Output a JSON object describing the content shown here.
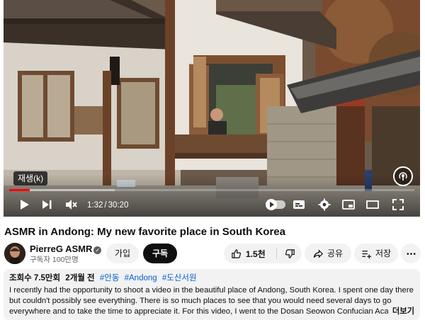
{
  "player": {
    "tooltip": "재생(k)",
    "current_time": "1:32",
    "time_separator": "/",
    "duration": "30:20",
    "progress_played": 0.0505,
    "progress_loaded": 0.26,
    "icons": [
      "play-icon",
      "next-icon",
      "mute-icon",
      "autoplay-toggle",
      "subtitles-icon",
      "settings-icon",
      "miniplayer-icon",
      "theater-icon",
      "fullscreen-icon",
      "podcast-icon"
    ]
  },
  "video": {
    "title": "ASMR in Andong: My new favorite place in South Korea"
  },
  "channel": {
    "name": "PierreG ASMR",
    "subscribers": "구독자 100만명",
    "join_label": "가입",
    "subscribe_label": "구독"
  },
  "actions": {
    "like_count": "1.5천",
    "share_label": "공유",
    "save_label": "저장"
  },
  "description": {
    "views": "조회수 7.5만회",
    "date": "2개월 전",
    "tags": [
      "#안동",
      "#Andong",
      "#도산서원"
    ],
    "text": "I recently had the opportunity to shoot a video in the beautiful place of Andong, South Korea. I spent one day there but couldn't possibly see everything. There is so much places to see that you would need several days to go everywhere and to take the time to appreciate it. For this video, I went to the Dosan Seowon Confucian Academy, Yekki Village, Seonseong",
    "more_label": "더보기"
  },
  "colors": {
    "progress_red": "#ff0000",
    "link_blue": "#065fd4",
    "pill_bg": "#f2f2f2",
    "subscribe_bg": "#0f0f0f"
  }
}
